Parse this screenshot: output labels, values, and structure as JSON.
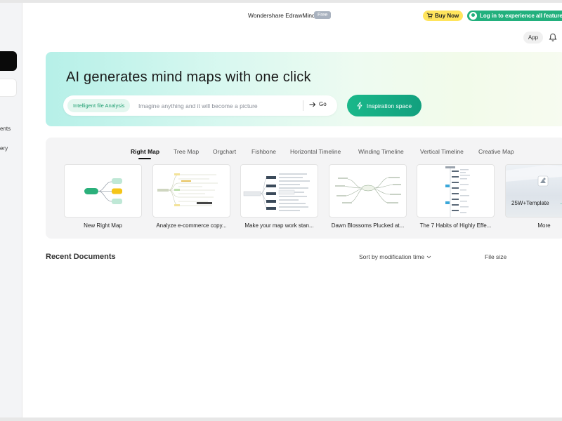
{
  "header": {
    "app_title": "Wondershare EdrawMind",
    "plan_badge": "Free",
    "buy_label": "Buy Now",
    "login_label": "Log in to experience all features",
    "app_button": "App"
  },
  "sidebar": {
    "items": [
      {
        "label": "ents"
      },
      {
        "label": "ery"
      }
    ]
  },
  "banner": {
    "title": "AI generates mind maps with one click",
    "chip_label": "Intelligent file Analysis",
    "search_placeholder": "Imagine anything and it will become a picture",
    "go_label": "Go",
    "inspiration_label": "Inspiration space"
  },
  "templates": {
    "tabs": [
      {
        "label": "Right Map",
        "active": true
      },
      {
        "label": "Tree Map"
      },
      {
        "label": "Orgchart"
      },
      {
        "label": "Fishbone"
      },
      {
        "label": "Horizontal Timeline"
      },
      {
        "label": "Winding Timeline"
      },
      {
        "label": "Vertical Timeline"
      },
      {
        "label": "Creative Map"
      }
    ],
    "cards": [
      {
        "label": "New Right Map"
      },
      {
        "label": "Analyze e-commerce copy..."
      },
      {
        "label": "Make your map work stan..."
      },
      {
        "label": "Dawn Blossoms Plucked at..."
      },
      {
        "label": "The 7 Habits of Highly Effe..."
      },
      {
        "label": "More",
        "badge": "25W+Template",
        "arrow": "→"
      }
    ]
  },
  "recent": {
    "title": "Recent Documents",
    "sort_label": "Sort by modification time",
    "size_label": "File size"
  },
  "colors": {
    "accent_green": "#22b07d",
    "buy_yellow": "#ffe45c"
  }
}
